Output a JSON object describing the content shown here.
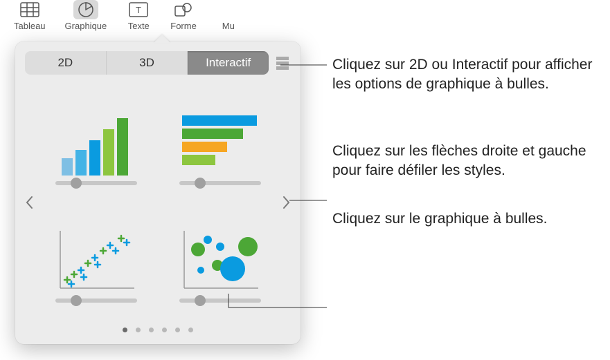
{
  "toolbar": {
    "items": [
      {
        "label": "Tableau"
      },
      {
        "label": "Graphique"
      },
      {
        "label": "Texte"
      },
      {
        "label": "Forme"
      },
      {
        "label": "Mu"
      }
    ]
  },
  "segmented": {
    "items": [
      "2D",
      "3D",
      "Interactif"
    ]
  },
  "callouts": {
    "tabs": "Cliquez sur 2D ou Interactif pour afficher les options de graphique à bulles.",
    "arrows": "Cliquez sur les flèches droite et gauche pour faire défiler les styles.",
    "bubble": "Cliquez sur le graphique à bulles."
  }
}
